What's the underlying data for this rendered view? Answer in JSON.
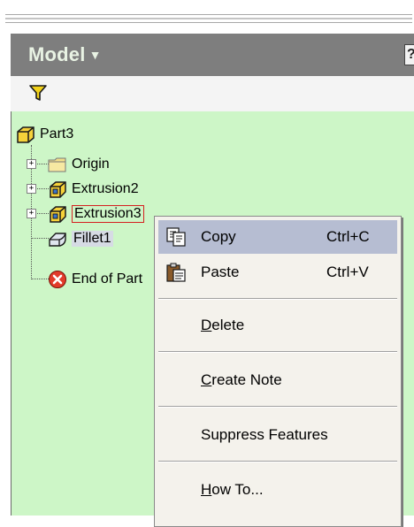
{
  "panel": {
    "title": "Model",
    "help_glyph": "?"
  },
  "tree": {
    "root": "Part3",
    "items": [
      {
        "label": "Origin",
        "icon": "folder-icon"
      },
      {
        "label": "Extrusion2",
        "icon": "extrusion-icon"
      },
      {
        "label": "Extrusion3",
        "icon": "extrusion-icon"
      },
      {
        "label": "Fillet1",
        "icon": "fillet-icon"
      },
      {
        "label": "End of Part",
        "icon": "end-of-part-icon"
      }
    ]
  },
  "context_menu": {
    "copy": {
      "label": "Copy",
      "shortcut": "Ctrl+C"
    },
    "paste": {
      "label": "Paste",
      "shortcut": "Ctrl+V"
    },
    "delete": {
      "label_pre": "",
      "label_ul": "D",
      "label_post": "elete"
    },
    "create_note": {
      "label_pre": "",
      "label_ul": "C",
      "label_post": "reate Note"
    },
    "suppress": {
      "label": "Suppress Features"
    },
    "howto": {
      "label_pre": "",
      "label_ul": "H",
      "label_post": "ow To..."
    }
  },
  "colors": {
    "header": "#7e7e7e",
    "tree_bg": "#cdf6c7",
    "menu_highlight": "#b6bdd2",
    "selection_border": "#d42020"
  }
}
